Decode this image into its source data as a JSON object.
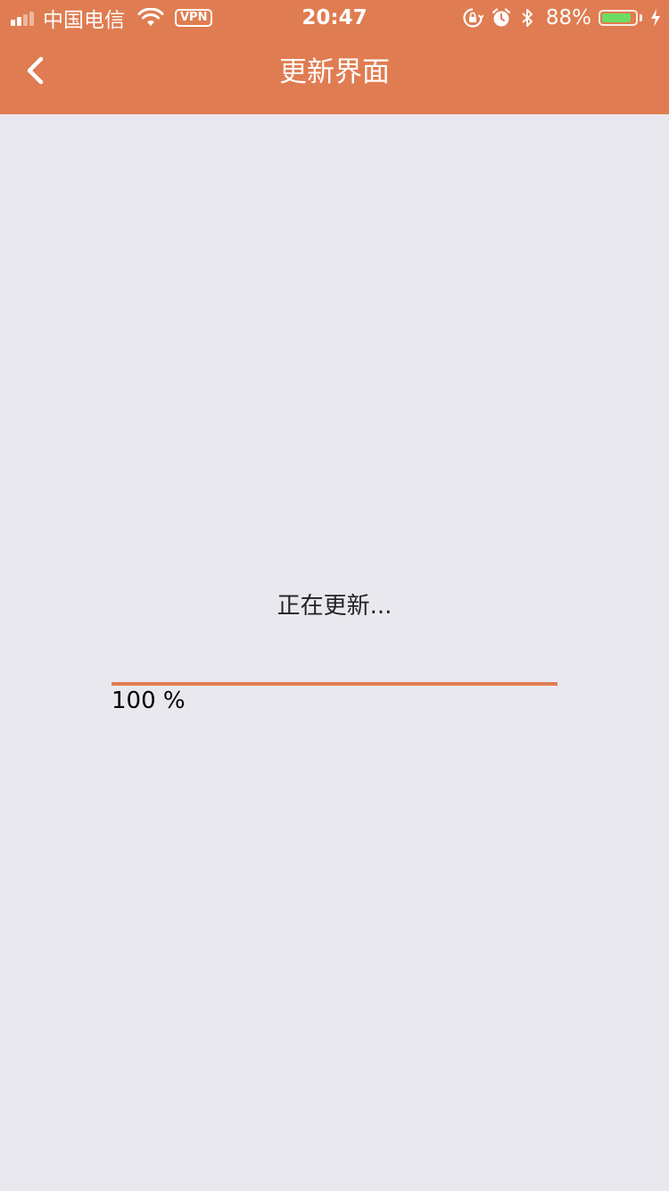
{
  "status_bar": {
    "carrier": "中国电信",
    "vpn_label": "VPN",
    "time": "20:47",
    "battery_percent": "88%",
    "battery_level": 0.88,
    "icons": [
      "signal-icon",
      "wifi-icon",
      "vpn-icon",
      "rotation-lock-icon",
      "alarm-icon",
      "bluetooth-icon",
      "battery-icon",
      "charging-icon"
    ]
  },
  "nav": {
    "title": "更新界面",
    "back_icon": "chevron-left-icon"
  },
  "update": {
    "message": "正在更新...",
    "progress_value": 1.0,
    "progress_label": "100 %"
  },
  "colors": {
    "accent": "#e07c51",
    "background": "#e9e8ee",
    "battery_green": "#6ddc62"
  }
}
